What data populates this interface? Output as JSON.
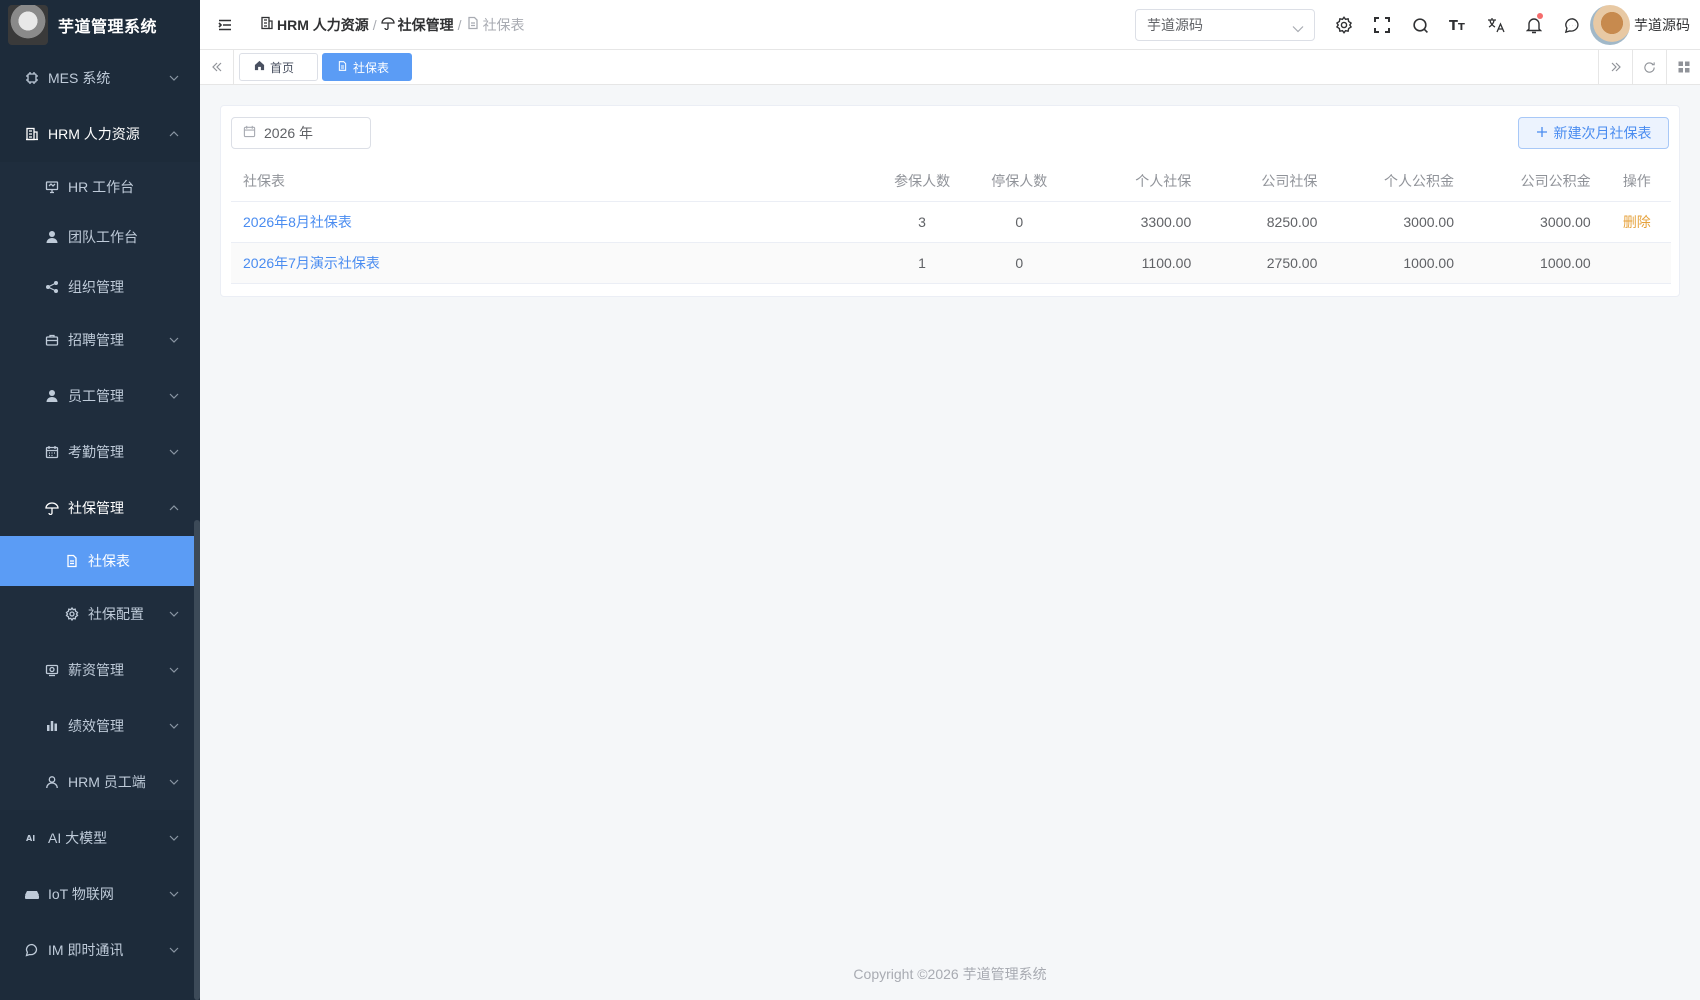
{
  "app": {
    "title": "芋道管理系统"
  },
  "sidebar": {
    "items": [
      {
        "label": "MES 系统",
        "icon": "chip-icon"
      },
      {
        "label": "HRM 人力资源",
        "icon": "building-icon"
      },
      {
        "label": "HR 工作台",
        "icon": "monitor-icon"
      },
      {
        "label": "团队工作台",
        "icon": "person-icon"
      },
      {
        "label": "组织管理",
        "icon": "share-icon"
      },
      {
        "label": "招聘管理",
        "icon": "briefcase-icon"
      },
      {
        "label": "员工管理",
        "icon": "person-icon"
      },
      {
        "label": "考勤管理",
        "icon": "calendar-icon"
      },
      {
        "label": "社保管理",
        "icon": "umbrella-icon"
      },
      {
        "label": "社保表",
        "icon": "document-icon"
      },
      {
        "label": "社保配置",
        "icon": "gear-icon"
      },
      {
        "label": "薪资管理",
        "icon": "money-icon"
      },
      {
        "label": "绩效管理",
        "icon": "bar-chart-icon"
      },
      {
        "label": "HRM 员工端",
        "icon": "user-outline-icon"
      },
      {
        "label": "AI 大模型",
        "icon": "ai-icon"
      },
      {
        "label": "IoT 物联网",
        "icon": "router-icon"
      },
      {
        "label": "IM 即时通讯",
        "icon": "chat-icon"
      }
    ]
  },
  "header": {
    "breadcrumbs": [
      "HRM 人力资源",
      "社保管理",
      "社保表"
    ],
    "tenant": "芋道源码",
    "username": "芋道源码"
  },
  "tags": {
    "home": "首页",
    "active": "社保表"
  },
  "toolbar": {
    "year": "2026 年",
    "new_button": "新建次月社保表"
  },
  "table": {
    "columns": [
      "社保表",
      "参保人数",
      "停保人数",
      "个人社保",
      "公司社保",
      "个人公积金",
      "公司公积金",
      "操作"
    ],
    "rows": [
      {
        "name": "2026年8月社保表",
        "insured": "3",
        "stopped": "0",
        "personal_ss": "3300.00",
        "company_ss": "8250.00",
        "personal_hf": "3000.00",
        "company_hf": "3000.00",
        "action": "删除"
      },
      {
        "name": "2026年7月演示社保表",
        "insured": "1",
        "stopped": "0",
        "personal_ss": "1100.00",
        "company_ss": "2750.00",
        "personal_hf": "1000.00",
        "company_hf": "1000.00",
        "action": ""
      }
    ]
  },
  "footer": {
    "copyright": "Copyright ©2026 芋道管理系统"
  }
}
